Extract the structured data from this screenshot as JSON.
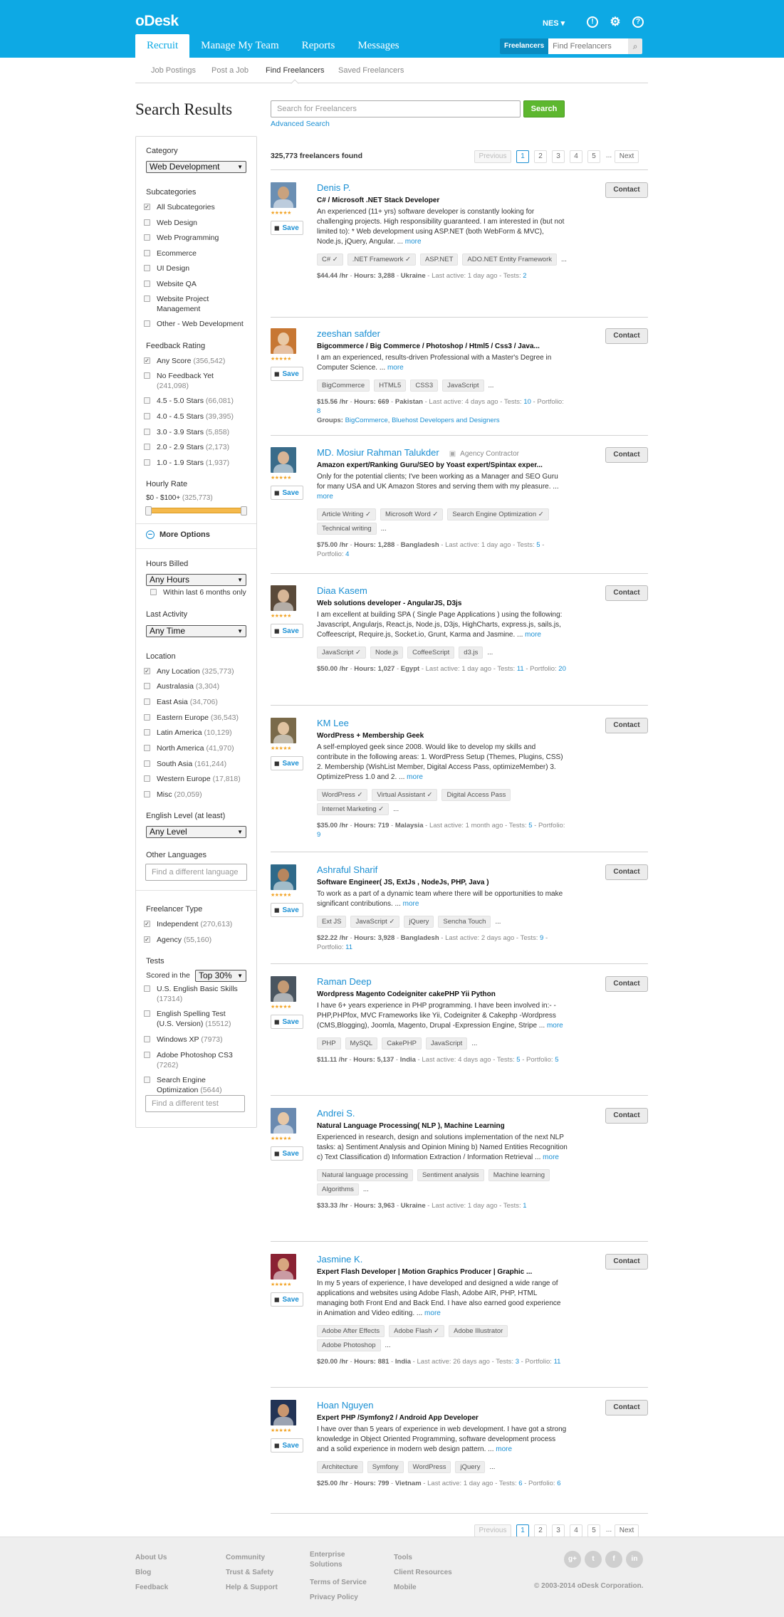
{
  "app": {
    "logo": "oDesk",
    "user": "NES ▾"
  },
  "nav": {
    "tabs": [
      "Recruit",
      "Manage My Team",
      "Reports",
      "Messages"
    ],
    "search_scope": "Freelancers",
    "search_placeholder": "Find Freelancers"
  },
  "subnav": [
    "Job Postings",
    "Post a Job",
    "Find Freelancers",
    "Saved Freelancers"
  ],
  "page_title": "Search Results",
  "search": {
    "placeholder": "Search for Freelancers",
    "button": "Search",
    "advanced": "Advanced Search"
  },
  "results_count": "325,773 freelancers found",
  "pager": {
    "prev": "Previous",
    "pages": [
      "1",
      "2",
      "3",
      "4",
      "5"
    ],
    "dots": "...",
    "next": "Next"
  },
  "sidebar": {
    "category_label": "Category",
    "category_value": "Web Development",
    "subcategories_label": "Subcategories",
    "subcategories": [
      {
        "label": "All Subcategories",
        "checked": true
      },
      {
        "label": "Web Design",
        "checked": false
      },
      {
        "label": "Web Programming",
        "checked": false
      },
      {
        "label": "Ecommerce",
        "checked": false
      },
      {
        "label": "UI Design",
        "checked": false
      },
      {
        "label": "Website QA",
        "checked": false
      },
      {
        "label": "Website Project Management",
        "checked": false
      },
      {
        "label": "Other - Web Development",
        "checked": false
      }
    ],
    "feedback_label": "Feedback Rating",
    "feedback": [
      {
        "label": "Any Score",
        "count": "(356,542)",
        "checked": true
      },
      {
        "label": "No Feedback Yet",
        "count": "(241,098)",
        "checked": false
      },
      {
        "label": "4.5 - 5.0 Stars",
        "count": "(66,081)",
        "checked": false
      },
      {
        "label": "4.0 - 4.5 Stars",
        "count": "(39,395)",
        "checked": false
      },
      {
        "label": "3.0 - 3.9 Stars",
        "count": "(5,858)",
        "checked": false
      },
      {
        "label": "2.0 - 2.9 Stars",
        "count": "(2,173)",
        "checked": false
      },
      {
        "label": "1.0 - 1.9 Stars",
        "count": "(1,937)",
        "checked": false
      }
    ],
    "hourly_label": "Hourly Rate",
    "hourly_range": "$0 - $100+",
    "hourly_count": "(325,773)",
    "more_options": "More Options",
    "hours_billed_label": "Hours Billed",
    "hours_billed_value": "Any Hours",
    "within_6_months": "Within last 6 months only",
    "last_activity_label": "Last Activity",
    "last_activity_value": "Any Time",
    "location_label": "Location",
    "locations": [
      {
        "label": "Any Location",
        "count": "(325,773)",
        "checked": true
      },
      {
        "label": "Australasia",
        "count": "(3,304)",
        "checked": false
      },
      {
        "label": "East Asia",
        "count": "(34,706)",
        "checked": false
      },
      {
        "label": "Eastern Europe",
        "count": "(36,543)",
        "checked": false
      },
      {
        "label": "Latin America",
        "count": "(10,129)",
        "checked": false
      },
      {
        "label": "North America",
        "count": "(41,970)",
        "checked": false
      },
      {
        "label": "South Asia",
        "count": "(161,244)",
        "checked": false
      },
      {
        "label": "Western Europe",
        "count": "(17,818)",
        "checked": false
      },
      {
        "label": "Misc",
        "count": "(20,059)",
        "checked": false
      }
    ],
    "english_label": "English Level (at least)",
    "english_value": "Any Level",
    "other_lang_label": "Other Languages",
    "other_lang_placeholder": "Find a different language",
    "ftype_label": "Freelancer Type",
    "ftypes": [
      {
        "label": "Independent",
        "count": "(270,613)",
        "checked": true
      },
      {
        "label": "Agency",
        "count": "(55,160)",
        "checked": true
      }
    ],
    "tests_label": "Tests",
    "scored_label": "Scored in the",
    "scored_value": "Top 30%",
    "tests": [
      {
        "label": "U.S. English Basic Skills",
        "count": "(17314)"
      },
      {
        "label": "English Spelling Test (U.S. Version)",
        "count": "(15512)"
      },
      {
        "label": "Windows XP",
        "count": "(7973)"
      },
      {
        "label": "Adobe Photoshop CS3",
        "count": "(7262)"
      },
      {
        "label": "Search Engine Optimization",
        "count": "(5644)"
      }
    ],
    "test_placeholder": "Find a different test"
  },
  "results": [
    {
      "name": "Denis P.",
      "title": "C# / Microsoft .NET Stack Developer",
      "desc": "An experienced (11+ yrs) software developer is constantly looking for challenging projects. High responsibility guaranteed. I am interested in (but not limited to): * Web development using ASP.NET (both WebForm & MVC), Node.js, jQuery, Angular. ...",
      "skills": [
        "C# ✓",
        ".NET Framework ✓",
        "ASP.NET",
        "ADO.NET Entity Framework"
      ],
      "rate": "$44.44 /hr",
      "hours": "3,288",
      "country": "Ukraine",
      "active": "1 day ago",
      "tests": "2",
      "portfolio": "",
      "groups": []
    },
    {
      "name": "zeeshan safder",
      "title": "Bigcommerce / Big Commerce / Photoshop / Html5 / Css3 / Java...",
      "desc": "I am an experienced, results-driven Professional with a Master's Degree in Computer Science. ...",
      "skills": [
        "BigCommerce",
        "HTML5",
        "CSS3",
        "JavaScript"
      ],
      "rate": "$15.56 /hr",
      "hours": "669",
      "country": "Pakistan",
      "active": "4 days ago",
      "tests": "10",
      "portfolio": "8",
      "groups": [
        "BigCommerce",
        "Bluehost Developers and Designers"
      ]
    },
    {
      "name": "MD. Mosiur Rahman Talukder",
      "agency": "Agency Contractor",
      "title": "Amazon expert/Ranking Guru/SEO by Yoast expert/Spintax exper...",
      "desc": "Only for the potential clients; I've been working as a Manager  and SEO Guru for many USA and UK Amazon Stores and serving them with my pleasure. ...",
      "skills": [
        "Article Writing ✓",
        "Microsoft Word ✓",
        "Search Engine Optimization ✓",
        "Technical writing"
      ],
      "rate": "$75.00 /hr",
      "hours": "1,288",
      "country": "Bangladesh",
      "active": "1 day ago",
      "tests": "5",
      "portfolio": "4",
      "groups": []
    },
    {
      "name": "Diaa Kasem",
      "title": "Web solutions developer - AngularJS, D3js",
      "desc": "I am excellent at building SPA ( Single Page Applications ) using the following: Javascript, Angularjs, React.js, Node.js, D3js, HighCharts, express.js, sails.js, Coffeescript, Require.js, Socket.io, Grunt, Karma and Jasmine. ...",
      "skills": [
        "JavaScript ✓",
        "Node.js",
        "CoffeeScript",
        "d3.js"
      ],
      "rate": "$50.00 /hr",
      "hours": "1,027",
      "country": "Egypt",
      "active": "1 day ago",
      "tests": "11",
      "portfolio": "20",
      "groups": []
    },
    {
      "name": "KM Lee",
      "title": "WordPress + Membership Geek",
      "desc": "A self-employed geek since 2008. Would like to develop my skills and contribute in the following areas: 1. WordPress Setup (Themes, Plugins, CSS) 2. Membership (WishList Member, Digital Access Pass, optimizeMember) 3. OptimizePress 1.0 and 2. ...",
      "skills": [
        "WordPress ✓",
        "Virtual Assistant ✓",
        "Digital Access Pass",
        "Internet Marketing ✓"
      ],
      "rate": "$35.00 /hr",
      "hours": "719",
      "country": "Malaysia",
      "active": "1 month ago",
      "tests": "5",
      "portfolio": "9",
      "groups": []
    },
    {
      "name": "Ashraful Sharif",
      "title": "Software Engineer( JS, ExtJs , NodeJs, PHP, Java )",
      "desc": "To work as a part of a dynamic team where there will be opportunities to make significant contributions. ...",
      "skills": [
        "Ext JS",
        "JavaScript ✓",
        "jQuery",
        "Sencha Touch"
      ],
      "rate": "$22.22 /hr",
      "hours": "3,928",
      "country": "Bangladesh",
      "active": "2 days ago",
      "tests": "9",
      "portfolio": "11",
      "groups": []
    },
    {
      "name": "Raman Deep",
      "title": "Wordpress Magento Codeigniter cakePHP Yii Python",
      "desc": "I have 6+ years experience in PHP programming. I have been involved in:- -PHP,PHPfox, MVC Frameworks like Yii, Codeigniter & Cakephp -Wordpress (CMS,Blogging), Joomla, Magento, Drupal -Expression Engine, Stripe ...",
      "skills": [
        "PHP",
        "MySQL",
        "CakePHP",
        "JavaScript"
      ],
      "rate": "$11.11 /hr",
      "hours": "5,137",
      "country": "India",
      "active": "4 days ago",
      "tests": "5",
      "portfolio": "5",
      "groups": []
    },
    {
      "name": "Andrei S.",
      "title": "Natural Language Processing( NLP ), Machine Learning",
      "desc": "Experienced in research, design and solutions implementation of the next NLP  tasks: a) Sentiment Analysis and Opinion Mining b) Named Entities Recognition c) Text Classification d) Information Extraction / Information Retrieval ...",
      "skills": [
        "Natural language processing",
        "Sentiment analysis",
        "Machine learning",
        "Algorithms"
      ],
      "rate": "$33.33 /hr",
      "hours": "3,963",
      "country": "Ukraine",
      "active": "1 day ago",
      "tests": "1",
      "portfolio": "",
      "groups": []
    },
    {
      "name": "Jasmine K.",
      "title": "Expert Flash Developer | Motion Graphics Producer | Graphic ...",
      "desc": "In my 5 years of experience, I have developed and designed a wide range of applications and websites using Adobe Flash, Adobe AIR, PHP, HTML managing both Front End and Back End. I have also earned good experience in Animation and Video editing. ...",
      "skills": [
        "Adobe After Effects",
        "Adobe Flash ✓",
        "Adobe Illustrator",
        "Adobe Photoshop"
      ],
      "rate": "$20.00 /hr",
      "hours": "881",
      "country": "India",
      "active": "26 days ago",
      "tests": "3",
      "portfolio": "11",
      "groups": []
    },
    {
      "name": "Hoan Nguyen",
      "title": "Expert PHP /Symfony2 / Android App Developer",
      "desc": "I have over than 5 years of experience in web development. I have got a strong knowledge in Object Oriented Programming, software development process and a solid experience in modern web design pattern. ...",
      "skills": [
        "Architecture",
        "Symfony",
        "WordPress",
        "jQuery"
      ],
      "rate": "$25.00 /hr",
      "hours": "799",
      "country": "Vietnam",
      "active": "1 day ago",
      "tests": "6",
      "portfolio": "6",
      "groups": []
    }
  ],
  "labels": {
    "save": "Save",
    "contact": "Contact",
    "more": "more",
    "hours": "Hours:",
    "last_active": "Last active:",
    "tests": "Tests:",
    "portfolio": "Portfolio:",
    "groups": "Groups:",
    "ellipsis": "..."
  },
  "footer": {
    "col1": [
      "About Us",
      "Blog",
      "Feedback"
    ],
    "col2": [
      "Community",
      "Trust & Safety",
      "Help & Support"
    ],
    "col3": [
      "Enterprise Solutions",
      "Terms of Service",
      "Privacy Policy"
    ],
    "col4": [
      "Tools",
      "Client Resources",
      "Mobile"
    ],
    "social": [
      "g+",
      "t",
      "f",
      "in"
    ],
    "copyright": "© 2003-2014 oDesk Corporation."
  },
  "colors": {
    "brand": "#0da9e4",
    "link": "#1a8fd3",
    "search_button": "#5db72f",
    "stars": "#f2a324"
  }
}
